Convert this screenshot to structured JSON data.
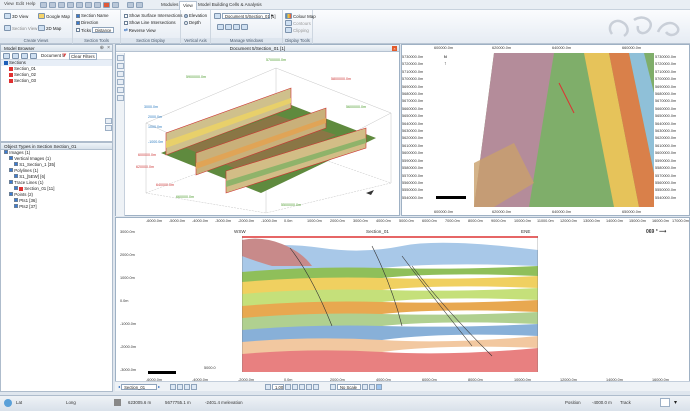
{
  "titlebar": {
    "menu": [
      "View",
      "Edit",
      "Help"
    ],
    "tabs": [
      "Modules",
      "View",
      "Model Building",
      "Cells & Analysis"
    ],
    "active_tab": "View"
  },
  "ribbon": {
    "create_views": {
      "label": "Create Views",
      "view3d": "3D View",
      "google_map": "Google Map",
      "section_view": "Section View",
      "view2d_map": "2D Map"
    },
    "section_tools": {
      "label": "Section Tools",
      "section_name": "Section Name",
      "direction": "Direction",
      "ticks": "Ticks",
      "ticks_value": "Distance"
    },
    "section_display": {
      "label": "Section Display",
      "show_surface_intersections": "Show Surface Intersections",
      "show_line_intersections": "Show Line Intersections",
      "reverse_view": "Reverse View"
    },
    "vertical_axis": {
      "label": "Vertical Axis",
      "elevation": "Elevation",
      "depth": "Depth"
    },
    "manage_windows": {
      "label": "Manage Windows",
      "window_select": "Document 5/Section_01 [1]"
    },
    "display_tools": {
      "label": "Display Tools",
      "colour_map": "Colour Map",
      "contours": "Contours",
      "clipping": "Clipping"
    }
  },
  "model_browser": {
    "title": "Model Browser",
    "document": "Document 5",
    "clear_filters": "Clear Filters",
    "sections_header": "Sections",
    "sections": [
      {
        "name": "Section_01",
        "color": "#e03030"
      },
      {
        "name": "Section_02",
        "color": "#e03030"
      },
      {
        "name": "Section_03",
        "color": "#e03030"
      }
    ]
  },
  "object_types": {
    "title": "Object Types in Section Section_01",
    "rows": [
      {
        "label": "Images (1)",
        "indent": 0
      },
      {
        "label": "Vertical Images (1)",
        "indent": 1
      },
      {
        "label": "S1_Section_1 [35]",
        "indent": 2
      },
      {
        "label": "Polylines (1)",
        "indent": 1
      },
      {
        "label": "S1_[5EW] [6]",
        "indent": 2
      },
      {
        "label": "Trace Lines (1)",
        "indent": 1
      },
      {
        "label": "Section_01 [11]",
        "indent": 2
      },
      {
        "label": "Points (2)",
        "indent": 1
      },
      {
        "label": "Pts1 [36]",
        "indent": 2
      },
      {
        "label": "Pts2 [37]",
        "indent": 2
      }
    ]
  },
  "view3d": {
    "title": "Document 5/Section_01 [1]",
    "labels": [
      "5700000.0m",
      "5900000.0m",
      "5800000.0m",
      "5600000.0m",
      "620000.0m",
      "640000.0m",
      "660000.0m",
      "600000.0m",
      "5500000.0m",
      "3000.0m",
      "2000.0m",
      "1000.0m",
      "-1000.0m"
    ]
  },
  "viewmap": {
    "top_axis": [
      "600000.0m",
      "620000.0m",
      "640000.0m",
      "660000.0m"
    ],
    "bottom_axis": [
      "600000.0m",
      "620000.0m",
      "640000.0m",
      "650000.0m"
    ],
    "left_axis": [
      "5730000.0m",
      "5720000.0m",
      "5710000.0m",
      "5700000.0m",
      "5690000.0m",
      "5680000.0m",
      "5670000.0m",
      "5660000.0m",
      "5650000.0m",
      "5640000.0m",
      "5630000.0m",
      "5620000.0m",
      "5610000.0m",
      "5600000.0m",
      "5590000.0m",
      "5580000.0m",
      "5570000.0m",
      "5560000.0m",
      "5550000.0m",
      "5540000.0m"
    ],
    "right_axis": [
      "5730000.0m",
      "5720000.0m",
      "5710000.0m",
      "5700000.0m",
      "5690000.0m",
      "5680000.0m",
      "5670000.0m",
      "5660000.0m",
      "5650000.0m",
      "5640000.0m",
      "5630000.0m",
      "5620000.0m",
      "5610000.0m",
      "5600000.0m",
      "5590000.0m",
      "5580000.0m",
      "5570000.0m",
      "5560000.0m",
      "5550000.0m",
      "5540000.0m"
    ],
    "north_label": "N"
  },
  "section": {
    "title": "Section_01",
    "left_dir": "WSW",
    "right_dir": "ENE",
    "bearing": "069 °",
    "top_axis": [
      "-6000.0m",
      "-5000.0m",
      "-4000.0m",
      "-3000.0m",
      "-2000.0m",
      "-1000.0m",
      "0.0m",
      "1000.0m",
      "2000.0m",
      "3000.0m",
      "4000.0m",
      "5000.0m",
      "6000.0m",
      "7000.0m",
      "8000.0m",
      "9000.0m",
      "10000.0m",
      "11000.0m",
      "12000.0m",
      "13000.0m",
      "14000.0m",
      "15000.0m",
      "16000.0m",
      "17000.0m"
    ],
    "left_axis": [
      "3000.0m",
      "2000.0m",
      "1000.0m",
      "0.0m",
      "-1000.0m",
      "-2000.0m",
      "-3000.0m"
    ],
    "scale_label": "5000.0"
  },
  "section_toolbar": {
    "section_select": "Section_01",
    "zoom": "1.00",
    "scale_mode": "No Scale"
  },
  "statusbar": {
    "lat_label": "Lat",
    "long_label": "Long",
    "x_value": "623005.6 m",
    "y_value": "5677755.1 m",
    "z_value": "-2401.4 m",
    "elevation_label": "elevation",
    "position_label": "Position",
    "position_value": "-4000.0 m",
    "track_label": "Track"
  }
}
